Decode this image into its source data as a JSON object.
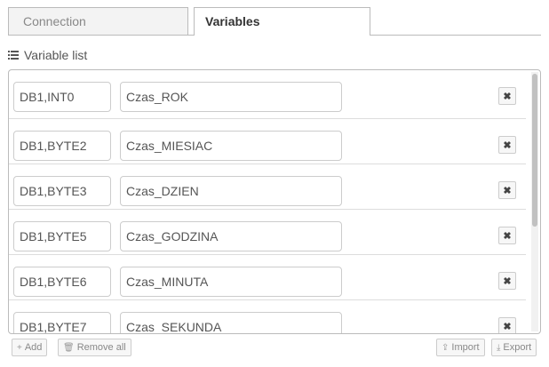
{
  "tabs": [
    {
      "label": "Connection",
      "active": false
    },
    {
      "label": "Variables",
      "active": true
    }
  ],
  "variable_list": {
    "title": "Variable list",
    "rows": [
      {
        "address": "DB1,INT0",
        "name": "Czas_ROK"
      },
      {
        "address": "DB1,BYTE2",
        "name": "Czas_MIESIAC"
      },
      {
        "address": "DB1,BYTE3",
        "name": "Czas_DZIEN"
      },
      {
        "address": "DB1,BYTE5",
        "name": "Czas_GODZINA"
      },
      {
        "address": "DB1,BYTE6",
        "name": "Czas_MINUTA"
      },
      {
        "address": "DB1,BYTE7",
        "name": "Czas_SEKUNDA"
      }
    ],
    "delete_glyph": "✖"
  },
  "buttons": {
    "add": {
      "icon": "plus-icon",
      "glyph": "+",
      "label": "Add"
    },
    "remove_all": {
      "icon": "trash-icon",
      "glyph": "🗑",
      "label": "Remove all"
    },
    "import": {
      "icon": "upload-icon",
      "glyph": "⇪",
      "label": "Import"
    },
    "export": {
      "icon": "download-icon",
      "glyph": "⤓",
      "label": "Export"
    }
  }
}
